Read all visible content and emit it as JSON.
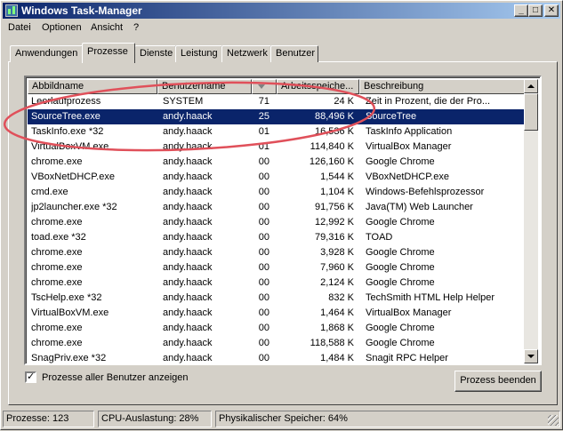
{
  "window": {
    "title": "Windows Task-Manager",
    "buttons": [
      "_",
      "□",
      "✕"
    ]
  },
  "menu": [
    "Datei",
    "Optionen",
    "Ansicht",
    "?"
  ],
  "tabs": [
    "Anwendungen",
    "Prozesse",
    "Dienste",
    "Leistung",
    "Netzwerk",
    "Benutzer"
  ],
  "active_tab": "Prozesse",
  "table": {
    "columns": [
      "Abbildname",
      "Benutzername",
      "",
      "Arbeitsspeiche...",
      "Beschreibung"
    ],
    "sort_column": 2,
    "selected_row": 1,
    "rows": [
      [
        "Leerlaufprozess",
        "SYSTEM",
        "71",
        "24 K",
        "Zeit in Prozent, die der Pro..."
      ],
      [
        "SourceTree.exe",
        "andy.haack",
        "25",
        "88,496 K",
        "SourceTree"
      ],
      [
        "TaskInfo.exe *32",
        "andy.haack",
        "01",
        "16,536 K",
        "TaskInfo Application"
      ],
      [
        "VirtualBoxVM.exe",
        "andy.haack",
        "01",
        "114,840 K",
        "VirtualBox Manager"
      ],
      [
        "chrome.exe",
        "andy.haack",
        "00",
        "126,160 K",
        "Google Chrome"
      ],
      [
        "VBoxNetDHCP.exe",
        "andy.haack",
        "00",
        "1,544 K",
        "VBoxNetDHCP.exe"
      ],
      [
        "cmd.exe",
        "andy.haack",
        "00",
        "1,104 K",
        "Windows-Befehlsprozessor"
      ],
      [
        "jp2launcher.exe *32",
        "andy.haack",
        "00",
        "91,756 K",
        "Java(TM) Web Launcher"
      ],
      [
        "chrome.exe",
        "andy.haack",
        "00",
        "12,992 K",
        "Google Chrome"
      ],
      [
        "toad.exe *32",
        "andy.haack",
        "00",
        "79,316 K",
        "TOAD"
      ],
      [
        "chrome.exe",
        "andy.haack",
        "00",
        "3,928 K",
        "Google Chrome"
      ],
      [
        "chrome.exe",
        "andy.haack",
        "00",
        "7,960 K",
        "Google Chrome"
      ],
      [
        "chrome.exe",
        "andy.haack",
        "00",
        "2,124 K",
        "Google Chrome"
      ],
      [
        "TscHelp.exe *32",
        "andy.haack",
        "00",
        "832 K",
        "TechSmith HTML Help Helper"
      ],
      [
        "VirtualBoxVM.exe",
        "andy.haack",
        "00",
        "1,464 K",
        "VirtualBox Manager"
      ],
      [
        "chrome.exe",
        "andy.haack",
        "00",
        "1,868 K",
        "Google Chrome"
      ],
      [
        "chrome.exe",
        "andy.haack",
        "00",
        "118,588 K",
        "Google Chrome"
      ],
      [
        "SnagPriv.exe *32",
        "andy.haack",
        "00",
        "1,484 K",
        "Snagit RPC Helper"
      ]
    ]
  },
  "show_all_users": {
    "label": "Prozesse aller Benutzer anzeigen",
    "checked": true,
    "mark": "✓"
  },
  "end_process_button": "Prozess beenden",
  "status": {
    "processes": "Prozesse: 123",
    "cpu": "CPU-Auslastung: 28%",
    "memory": "Physikalischer Speicher: 64%"
  },
  "colors": {
    "selection": "#0a246a",
    "annotation": "#e0505a"
  }
}
